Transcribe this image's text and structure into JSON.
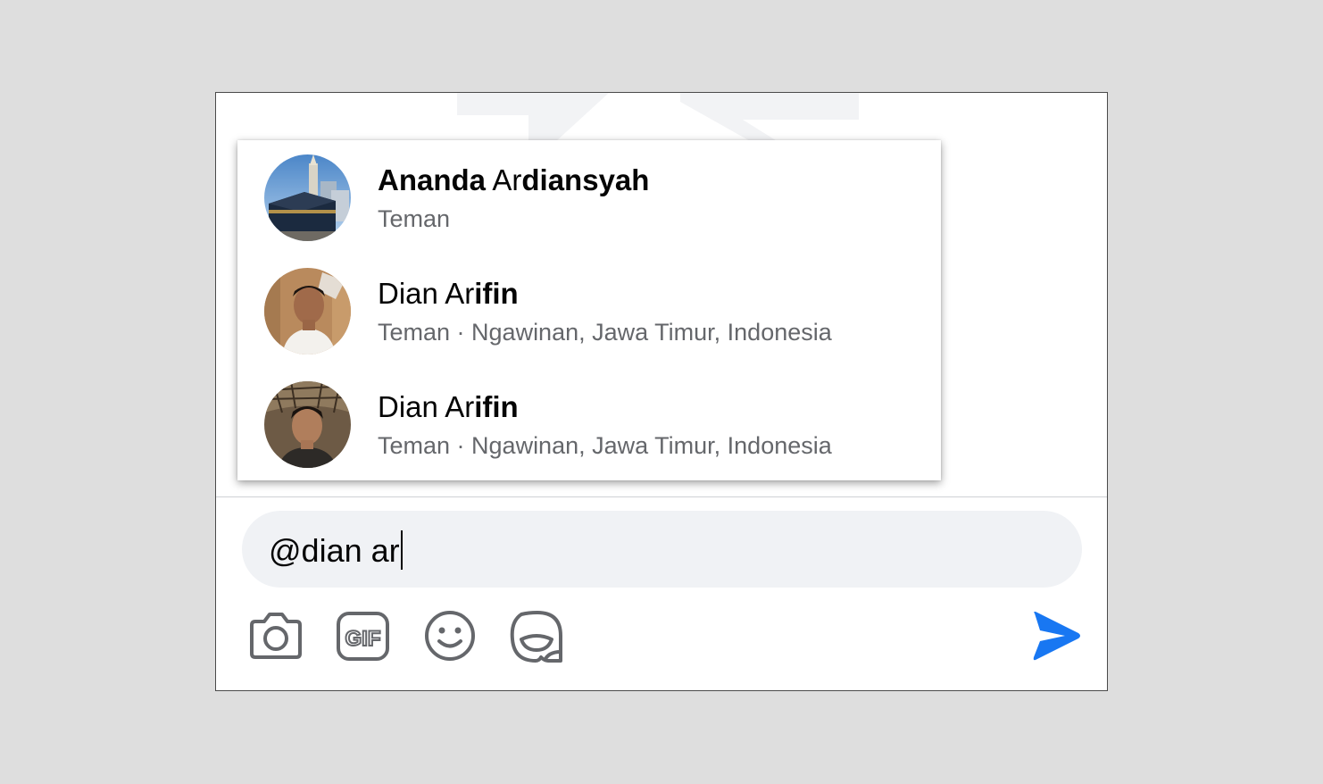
{
  "composer": {
    "value": "@dian ar"
  },
  "suggestions": [
    {
      "name_parts": [
        {
          "text": "Ananda",
          "bold": true
        },
        {
          "text": " Ar",
          "bold": false
        },
        {
          "text": "diansyah",
          "bold": true
        }
      ],
      "subtitle": "Teman"
    },
    {
      "name_parts": [
        {
          "text": "Dian Ar",
          "bold": false
        },
        {
          "text": "ifin",
          "bold": true
        }
      ],
      "subtitle": "Teman · Ngawinan, Jawa Timur, Indonesia"
    },
    {
      "name_parts": [
        {
          "text": "Dian Ar",
          "bold": false
        },
        {
          "text": "ifin",
          "bold": true
        }
      ],
      "subtitle": "Teman · Ngawinan, Jawa Timur, Indonesia"
    }
  ],
  "toolbar": {
    "icons": [
      "camera-icon",
      "gif-icon",
      "emoji-icon",
      "sticker-icon"
    ],
    "send_icon": "send-icon"
  },
  "colors": {
    "accent": "#1877f2",
    "icon": "#65676b",
    "input_bg": "#f0f2f5",
    "name": "#050505",
    "subtitle": "#65676b"
  }
}
